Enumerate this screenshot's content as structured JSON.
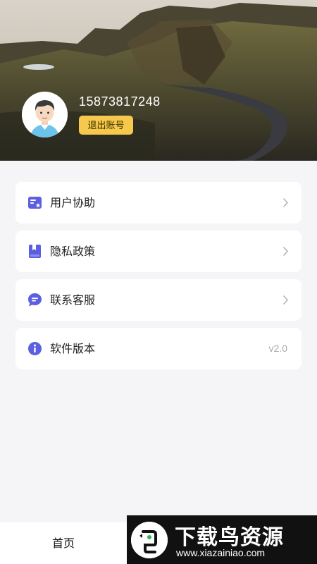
{
  "profile": {
    "phone": "15873817248",
    "logout_label": "退出账号"
  },
  "menu": {
    "items": [
      {
        "label": "用户协助",
        "icon": "card-star-icon",
        "trailing": "chevron"
      },
      {
        "label": "隐私政策",
        "icon": "book-icon",
        "trailing": "chevron"
      },
      {
        "label": "联系客服",
        "icon": "chat-bubble-icon",
        "trailing": "chevron"
      },
      {
        "label": "软件版本",
        "icon": "info-icon",
        "trailing": "v2.0"
      }
    ]
  },
  "tabbar": {
    "home_label": "首页"
  },
  "watermark": {
    "title": "下载鸟资源",
    "url": "www.xiazainiao.com"
  },
  "colors": {
    "accent": "#5b5fe0",
    "logout_bg": "#f6c84b",
    "background": "#f5f5f7"
  }
}
